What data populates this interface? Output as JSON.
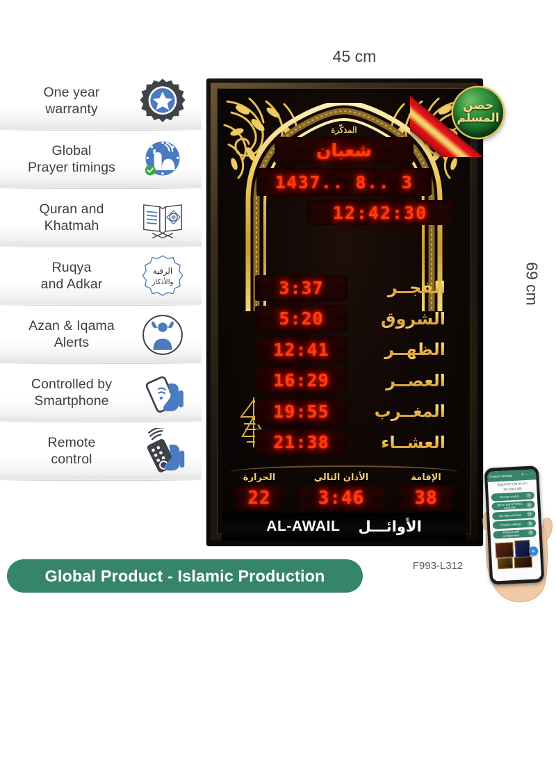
{
  "features": [
    {
      "label": "One year\nwarranty",
      "icon": "warranty-badge-icon"
    },
    {
      "label": "Global\nPrayer timings",
      "icon": "mosque-globe-icon"
    },
    {
      "label": "Quran and\nKhatmah",
      "icon": "open-book-icon"
    },
    {
      "label": "Ruqya\nand Adkar",
      "icon": "ruqya-seal-icon"
    },
    {
      "label": "Azan & Iqama\nAlerts",
      "icon": "muezzin-icon"
    },
    {
      "label": "Controlled by\nSmartphone",
      "icon": "smartphone-hand-icon"
    },
    {
      "label": "Remote\ncontrol",
      "icon": "remote-control-icon"
    }
  ],
  "dimensions": {
    "width": "45 cm",
    "height": "69 cm"
  },
  "clock": {
    "reminder_label": "المذكّرة",
    "month": "شعبان",
    "hijri_date": "1437.. 8.. 3",
    "time": "12:42:30",
    "prayers": [
      {
        "name": "الفجــر",
        "time": "3:37"
      },
      {
        "name": "الشروق",
        "time": "5:20"
      },
      {
        "name": "الظهــر",
        "time": "12:41"
      },
      {
        "name": "العصــر",
        "time": "16:29"
      },
      {
        "name": "المغــرب",
        "time": "19:55"
      },
      {
        "name": "العشــاء",
        "time": "21:38"
      }
    ],
    "status": [
      {
        "label": "الإقامة",
        "value": "38"
      },
      {
        "label": "الأذان التالي",
        "value": "3:46"
      },
      {
        "label": "الحرارة",
        "value": "22"
      }
    ],
    "mini_mark": "الأوائل",
    "brand_latin": "AL-AWAIL",
    "brand_arabic": "الأوائـــل"
  },
  "seal": {
    "line1": "حصن",
    "line2": "المسلم"
  },
  "banner": {
    "text": "Global Product - Islamic Production",
    "color": "#368569"
  },
  "model_number": "F993-L312",
  "phone_app": {
    "title": "Product settings",
    "datetime": "2021/07/07 ( 01:34:10 )",
    "ip": "192.168.1.108",
    "buttons": [
      {
        "label": "Remote control",
        "icon": "remote-icon"
      },
      {
        "label": "Quran and HYSNUL MUSLIM",
        "icon": "quran-icon"
      },
      {
        "label": "Set date and time",
        "icon": "clock-icon"
      },
      {
        "label": "Product settings",
        "icon": "gear-icon"
      },
      {
        "label": "Product WiFi configuration",
        "icon": "wifi-icon"
      }
    ]
  },
  "colors": {
    "icon_blue": "#4A7AC0",
    "icon_dark": "#3E4349",
    "green": "#368569",
    "led_red": "#FF3C10",
    "gold": "#F0C659",
    "ribbon_red": "#E8161D"
  }
}
